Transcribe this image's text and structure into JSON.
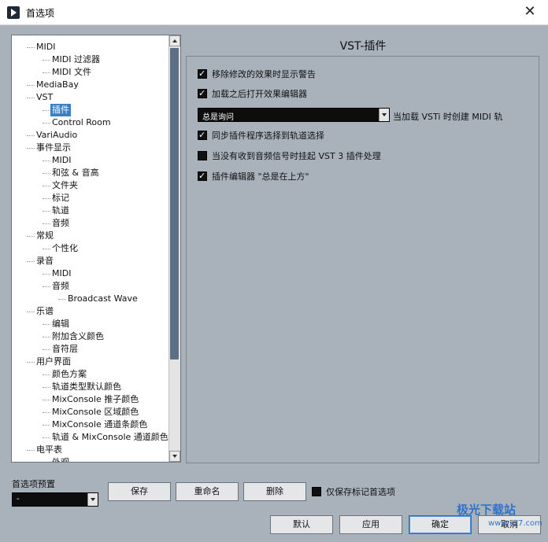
{
  "window": {
    "title": "首选项",
    "close_glyph": "✕"
  },
  "tree": {
    "items": [
      {
        "label": "MIDI",
        "level": 1
      },
      {
        "label": "MIDI 过滤器",
        "level": 2
      },
      {
        "label": "MIDI 文件",
        "level": 2
      },
      {
        "label": "MediaBay",
        "level": 1
      },
      {
        "label": "VST",
        "level": 1
      },
      {
        "label": "插件",
        "level": 2,
        "selected": true
      },
      {
        "label": "Control Room",
        "level": 2
      },
      {
        "label": "VariAudio",
        "level": 1
      },
      {
        "label": "事件显示",
        "level": 1
      },
      {
        "label": "MIDI",
        "level": 2
      },
      {
        "label": "和弦 & 音高",
        "level": 2
      },
      {
        "label": "文件夹",
        "level": 2
      },
      {
        "label": "标记",
        "level": 2
      },
      {
        "label": "轨道",
        "level": 2
      },
      {
        "label": "音频",
        "level": 2
      },
      {
        "label": "常规",
        "level": 1
      },
      {
        "label": "个性化",
        "level": 2
      },
      {
        "label": "录音",
        "level": 1
      },
      {
        "label": "MIDI",
        "level": 2
      },
      {
        "label": "音频",
        "level": 2
      },
      {
        "label": "Broadcast Wave",
        "level": 3
      },
      {
        "label": "乐谱",
        "level": 1
      },
      {
        "label": "编辑",
        "level": 2
      },
      {
        "label": "附加含义颜色",
        "level": 2
      },
      {
        "label": "音符层",
        "level": 2
      },
      {
        "label": "用户界面",
        "level": 1
      },
      {
        "label": "颜色方案",
        "level": 2
      },
      {
        "label": "轨道类型默认颜色",
        "level": 2
      },
      {
        "label": "MixConsole 推子颜色",
        "level": 2
      },
      {
        "label": "MixConsole 区域颜色",
        "level": 2
      },
      {
        "label": "MixConsole 通道条颜色",
        "level": 2
      },
      {
        "label": "轨道 & MixConsole 通道颜色",
        "level": 2
      },
      {
        "label": "电平表",
        "level": 1
      },
      {
        "label": "外观",
        "level": 2
      }
    ]
  },
  "panel": {
    "title": "VST-插件",
    "options": [
      {
        "label": "移除修改的效果时显示警告",
        "checked": true
      },
      {
        "label": "加载之后打开效果编辑器",
        "checked": true
      },
      {
        "label": "同步插件程序选择到轨道选择",
        "checked": true
      },
      {
        "label": "当没有收到音频信号时挂起 VST 3 插件处理",
        "checked": false
      },
      {
        "label": "插件编辑器 \"总是在上方\"",
        "checked": true
      }
    ],
    "instrument_combo": {
      "value": "总是询问",
      "side_label": "当加载 VSTi 时创建 MIDI 轨"
    }
  },
  "preset": {
    "label": "首选项预置",
    "value": "-",
    "save_label": "保存",
    "rename_label": "重命名",
    "delete_label": "删除",
    "marked_only_label": "仅保存标记首选项",
    "marked_only_checked": false
  },
  "footer": {
    "defaults_label": "默认",
    "apply_label": "应用",
    "ok_label": "确定",
    "cancel_label": "取消"
  },
  "watermark": {
    "text": "极光下载站",
    "url": "www.xz7.com"
  }
}
